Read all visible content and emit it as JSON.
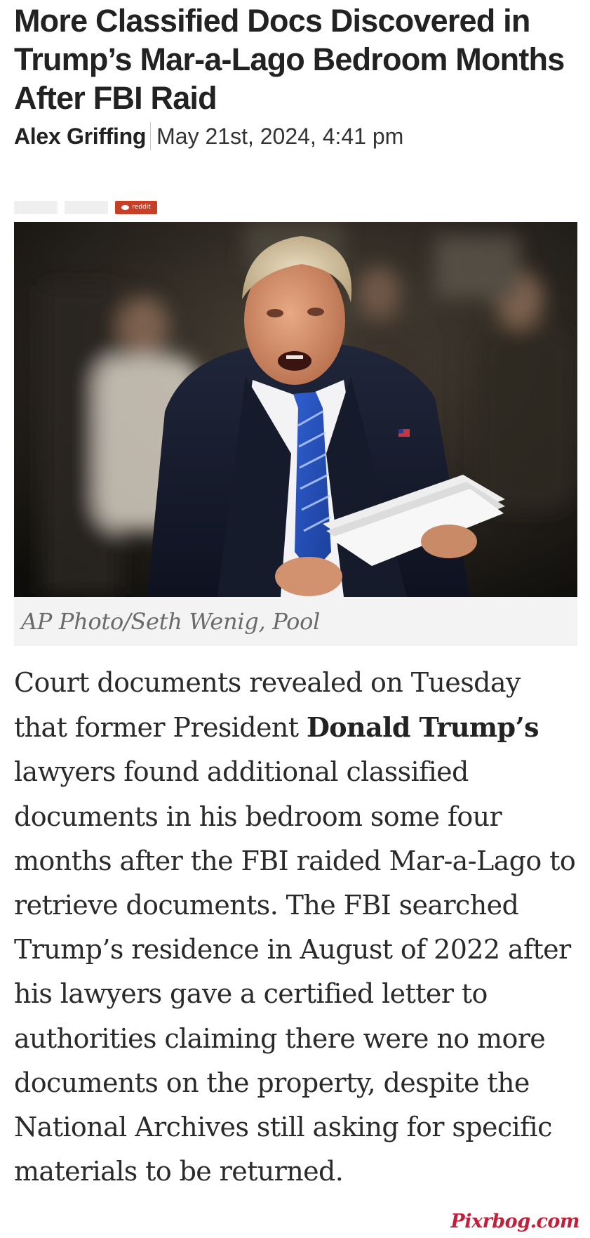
{
  "article": {
    "headline": "More Classified Docs Discovered in Trump’s Mar-a-Lago Bedroom Months After FBI Raid",
    "author": "Alex Griffing",
    "date": "May 21st, 2024, 4:41 pm"
  },
  "share": {
    "reddit_label": "reddit"
  },
  "photo": {
    "caption": "AP Photo/Seth Wenig, Pool"
  },
  "body": {
    "part1": "Court documents revealed on Tuesday that former President ",
    "bold": "Donald Trump’s",
    "part2": " lawyers found additional classified documents in his bedroom some four months after the FBI raided Mar-a-Lago to retrieve documents. The FBI searched Trump’s residence in August of 2022 after his lawyers gave a certified letter to authorities claiming there were no more documents on the property, despite the National Archives still asking for specific materials to be returned."
  },
  "watermark": {
    "text": "Pixrbog.com"
  }
}
